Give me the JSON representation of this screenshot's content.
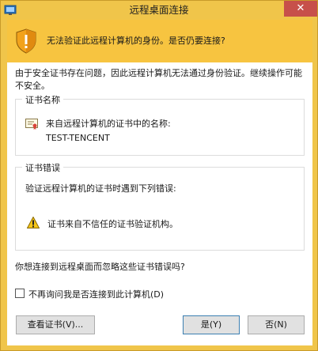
{
  "window": {
    "title": "远程桌面连接",
    "close_glyph": "✕"
  },
  "banner": {
    "text": "无法验证此远程计算机的身份。是否仍要连接?"
  },
  "intro": "由于安全证书存在问题，因此远程计算机无法通过身份验证。继续操作可能不安全。",
  "cert_name": {
    "title": "证书名称",
    "label": "来自远程计算机的证书中的名称:",
    "value": "TEST-TENCENT"
  },
  "cert_errors": {
    "title": "证书错误",
    "label": "验证远程计算机的证书时遇到下列错误:",
    "items": [
      "证书来自不信任的证书验证机构。"
    ]
  },
  "question": "你想连接到远程桌面而忽略这些证书错误吗?",
  "checkbox": {
    "label": "不再询问我是否连接到此计算机(D)",
    "checked": false
  },
  "buttons": {
    "view_cert": "查看证书(V)...",
    "yes": "是(Y)",
    "no": "否(N)"
  },
  "colors": {
    "banner": "#f7c440",
    "titlebar": "#f0c54a",
    "close": "#c7504a"
  },
  "icons": {
    "app": "remote-desktop-icon",
    "banner": "warning-shield-icon",
    "cert": "certificate-icon",
    "error": "warning-triangle-icon"
  }
}
